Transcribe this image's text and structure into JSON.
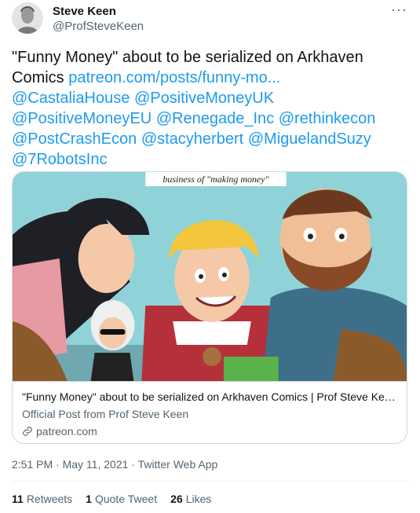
{
  "author": {
    "name": "Steve Keen",
    "handle": "@ProfSteveKeen"
  },
  "more_label": "···",
  "tweet": {
    "text_main": "\"Funny Money\" about to be serialized on Arkhaven Comics ",
    "link_url": "patreon.com/posts/funny-mo...",
    "mentions": [
      "@CastaliaHouse",
      "@PositiveMoneyUK",
      "@PositiveMoneyEU",
      "@Renegade_Inc",
      "@rethinkecon",
      "@PostCrashEcon",
      "@stacyherbert",
      "@MiguelandSuzy",
      "@7RobotsInc"
    ]
  },
  "card": {
    "image_caption": "business of \"making money\"",
    "title": "\"Funny Money\" about to be serialized on Arkhaven Comics | Prof Steve Keen o...",
    "description": "Official Post from Prof Steve Keen",
    "domain": "patreon.com"
  },
  "meta": {
    "time": "2:51 PM",
    "sep1": " · ",
    "date": "May 11, 2021",
    "sep2": " · ",
    "source": "Twitter Web App"
  },
  "stats": {
    "retweets_count": "11",
    "retweets_label": "Retweets",
    "quotes_count": "1",
    "quotes_label": "Quote Tweet",
    "likes_count": "26",
    "likes_label": "Likes"
  },
  "colors": {
    "link": "#1d9bf0",
    "muted": "#536471",
    "border": "#cfd9de"
  }
}
